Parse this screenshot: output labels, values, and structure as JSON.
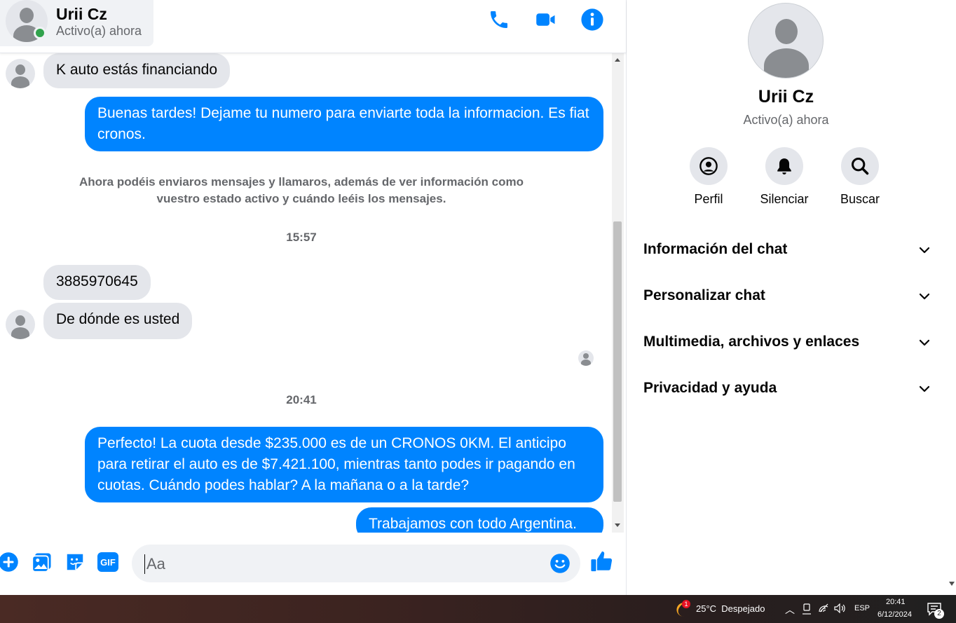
{
  "header": {
    "name": "Urii Cz",
    "status": "Activo(a) ahora"
  },
  "messages": {
    "m1": "K auto estás financiando",
    "m2": "Buenas tardes! Dejame tu numero para enviarte toda la informacion. Es fiat cronos.",
    "system_line1": "Ahora podéis enviaros mensajes y llamaros, además de ver información como",
    "system_line2": "vuestro estado activo y cuándo leéis los mensajes.",
    "time1": "15:57",
    "m3": "3885970645",
    "m4": "De dónde es usted",
    "time2": "20:41",
    "m5": "Perfecto! La cuota desde $235.000 es de un CRONOS 0KM. El anticipo para retirar el auto es de $7.421.100, mientras tanto podes ir pagando en cuotas. Cuándo podes hablar? A la mañana o a la tarde?",
    "m6": "Trabajamos con todo Argentina."
  },
  "composer": {
    "placeholder": "Aa",
    "gif_label": "GIF"
  },
  "sidebar": {
    "name": "Urii Cz",
    "status": "Activo(a) ahora",
    "actions": [
      "Perfil",
      "Silenciar",
      "Buscar"
    ],
    "sections": [
      "Información del chat",
      "Personalizar chat",
      "Multimedia, archivos y enlaces",
      "Privacidad y ayuda"
    ]
  },
  "taskbar": {
    "weather_badge": "1",
    "weather": "25°C  Despejado",
    "language": "ESP",
    "time": "20:41",
    "date": "6/12/2024",
    "notif_count": "2"
  },
  "colors": {
    "accent": "#0084ff",
    "incoming_bubble": "#e4e6eb",
    "online": "#31a24c"
  }
}
